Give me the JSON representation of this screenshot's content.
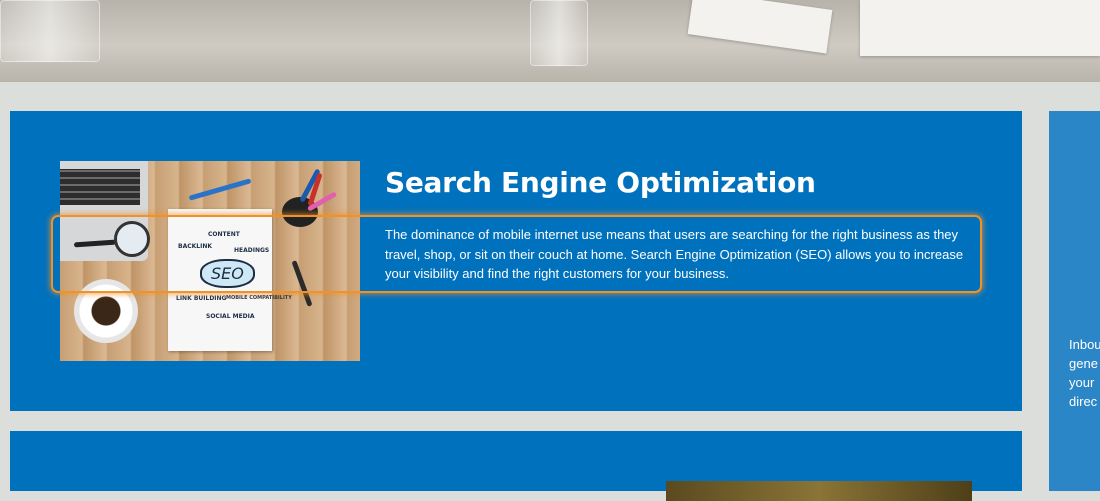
{
  "service": {
    "title": "Search Engine Optimization",
    "description": "The dominance of mobile internet use means that users are searching for the right business as they travel, shop, or sit on their couch at home. Search Engine Optimization (SEO) allows you to increase your visibility and find the right customers for your business.",
    "image_labels": {
      "seo": "SEO",
      "backlink": "BACKLINK",
      "content": "CONTENT",
      "headings": "HEADINGS",
      "link_building": "LINK BUILDING",
      "mobile_compatibility": "MOBILE COMPATIBILITY",
      "social_media": "SOCIAL MEDIA"
    }
  },
  "side_card": {
    "lines": [
      "Inbou",
      "gene",
      "your",
      "direc"
    ]
  },
  "colors": {
    "card_background": "#0071bc",
    "side_card_background": "#2a86c6",
    "page_background": "#dcdedb",
    "highlight_outline": "#f0922a",
    "text": "#ffffff"
  }
}
